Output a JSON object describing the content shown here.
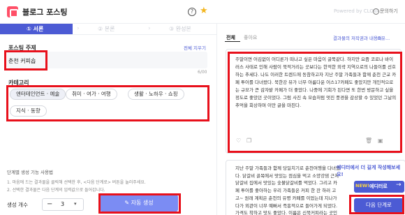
{
  "app": {
    "title": "블로그 포스팅",
    "powered_by": "Powered by CLOVA",
    "inquiry": "문의하기"
  },
  "steps": [
    {
      "label": "① 서론",
      "active": true
    },
    {
      "label": "② 본론",
      "active": false
    },
    {
      "label": "③ 완성본",
      "active": false
    }
  ],
  "form": {
    "topic_label": "포스팅 주제",
    "clear_all": "전체 지우기",
    "topic_value": "춘천 커피숍",
    "counter": "6/00",
    "category_label": "카테고리",
    "categories": [
      "엔터테인먼트 · 예술",
      "취미 · 여가 · 여행",
      "생활 · 노하우 · 쇼핑",
      "지식 · 동향"
    ]
  },
  "guide": {
    "title": "단계별 생성 기능 사용법",
    "line1": "1. 마음에 드는 결과물을 클릭해 선택한 후, <다음 단계로> 버튼을 눌러주세요.",
    "line2": "2. 선택한 결과물은 다음 단계의 입력값으로 들어갑니다."
  },
  "controls": {
    "count_label": "생성 개수",
    "count_minus": "−",
    "count_value": "3",
    "auto_generate": "자동 생성"
  },
  "results": {
    "tabs": [
      "전체",
      "좋아요"
    ],
    "view_all": "결과물의 저작권과 내용이",
    "copyright": "소유...",
    "card1_text": "주말이면 어김없이 어디론가 떠나고 싶은 마음이 굴뚝같다. 하지만 요즘 코로나 바이러스 사태로 인해 사람이 북적거리는 곳보다는 한적한 외곽 지역으로의 나들이를 선호하는 추세다. 나도 이러한 트렌드에 동참하고자 지난 주말 가족들과 함께 춘천 근교 카페 투어를 다녀왔다. 북한강 뷰가 너무 아름다운 어스17카페도 좋았지만 개인적으로는 규모가 큰 감자밭 카페가 더 좋았다. 나중에 기회가 된다면 또 한번 방문하고 싶을 정도로 좋았던 곳이었다. 그럼 사진 속 모습처럼 멋진 풍경을 감상할 수 있었던 그날의 추억을 회상하며 이만 글을 마친다.",
    "card2_text": "지난 주말 가족들과 함께 당일치기로 춘천여행을 다녀왔다. 닭갈비 골목에서 맛있는 점심을 먹고 소양강댐 근처 닭갈비 집에서 맛있는 숯불닭갈비를 먹었다. 그리고 카페 투어를 좋아하는 우리 가족들은 커피 한 잔 하러 고고~ 원래 계획은 춘천의 유명 카페를 이었는데 지나가다가 외관이 너무 예뻐서 즉흥적으로 들어가게 되었다. 가격도 착하고 맛도 좋았다. 이름은 신북커피라는 곳인데 내부도 아늑하고 따뜻한 분위기여서 가족들과 즐기에 좋은 날씨에 딱 어울리는 공간이었다. 나중에 기회가 된다면 다시",
    "card_icons": [
      "heart-icon",
      "copy-icon",
      "trash-icon",
      "save-icon"
    ]
  },
  "promo": {
    "headline": "에디터에서 더 길게 작성해보세요!",
    "badge": "NEW!",
    "label": "에디터로",
    "arrow": "→"
  },
  "next_button": "다음 단계로"
}
